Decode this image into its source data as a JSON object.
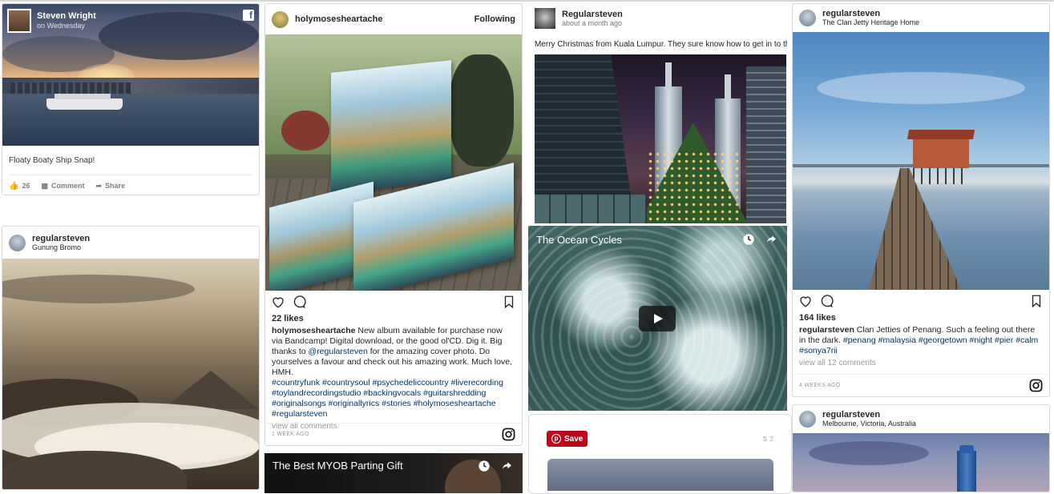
{
  "fb_post": {
    "author": "Steven Wright",
    "time": "on Wednesday",
    "caption": "Floaty Boaty Ship Snap!",
    "like_count": "26",
    "comment_label": "Comment",
    "share_label": "Share"
  },
  "bromo_post": {
    "user": "regularsteven",
    "location": "Gunung Bromo"
  },
  "album_post": {
    "user": "holymosesheartache",
    "follow_label": "Following",
    "likes": "22 likes",
    "caption_user": "holymosesheartache",
    "caption_text": " New album available for purchase now via Bandcamp! Digital download, or the good ol'CD. Dig it. Big thanks to ",
    "mention": "@regularsteven",
    "caption_text2": " for the amazing cover photo. Do yourselves a favour and check out his amazing work. Much love, HMH.",
    "hashtags": "#countryfunk #countrysoul #psychedeliccountry #liverecording #toylandrecordingstudio #backingvocals #guitarshredding #originalsongs #originallyrics #stories #holymosesheartache #regularsteven",
    "view_all": "view all comments",
    "ago": "1 WEEK AGO"
  },
  "myob_video": {
    "title": "The Best MYOB Parting Gift"
  },
  "gplus_post": {
    "author": "Regularsteven",
    "time": "about a month ago",
    "text": "Merry Christmas from Kuala Lumpur. They sure know how to get in to the"
  },
  "ocean_video": {
    "title": "The Ocean Cycles"
  },
  "pin_post": {
    "save_label": "Save",
    "count": "2"
  },
  "jetty_post": {
    "user": "regularsteven",
    "location": "The Clan Jetty Heritage Home",
    "likes": "164 likes",
    "caption_user": "regularsteven",
    "caption_text": " Clan Jetties of Penang. Such a feeling out there in the dark. ",
    "hashtags": "#penang #malaysia #georgetown #night #pier #calm #sonya7rii",
    "view_all": "view all 12 comments",
    "ago": "4 WEEKS AGO"
  },
  "melb_post": {
    "user": "regularsteven",
    "location": "Melbourne, Victoria, Australia"
  },
  "colors": {
    "instagram_text": "#262626",
    "hashtag": "#003569",
    "pinterest_red": "#bd081c",
    "muted": "#999999"
  }
}
